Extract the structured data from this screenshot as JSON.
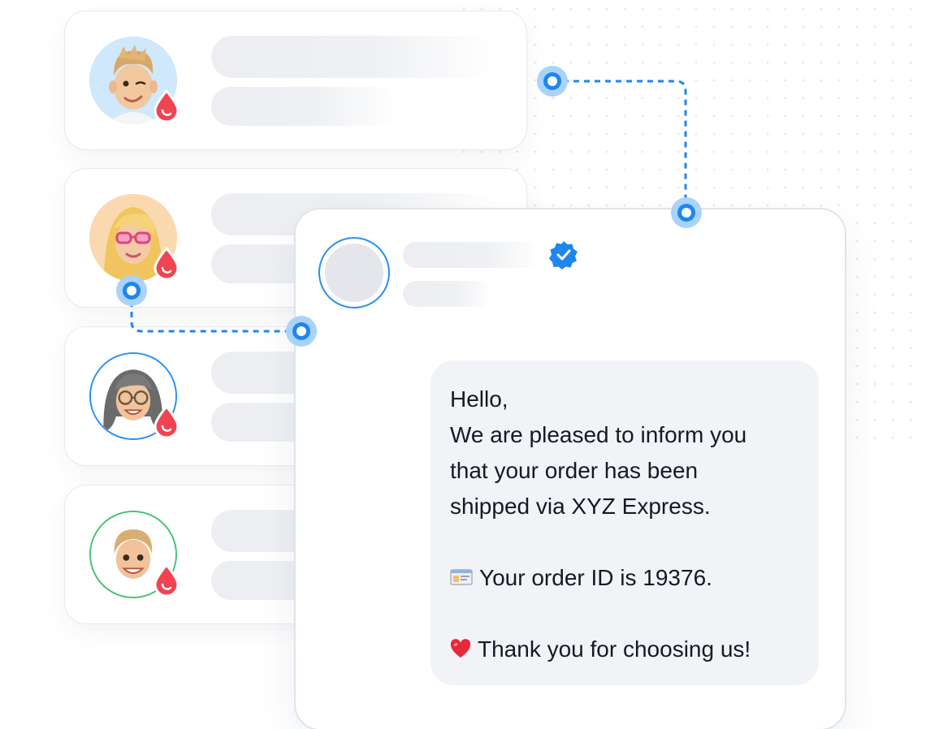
{
  "contacts": [
    {
      "avatar": "memoji-man-winking",
      "badge": "drop-icon",
      "ring": "none",
      "avatar_bg": "#cfe8fb"
    },
    {
      "avatar": "memoji-woman-blonde-pink-glasses",
      "badge": "drop-icon",
      "ring": "none",
      "avatar_bg": "#fbd9b0"
    },
    {
      "avatar": "memoji-woman-gray-hair-glasses",
      "badge": "drop-icon",
      "ring": "#2b8ef0",
      "avatar_bg": "#ffffff"
    },
    {
      "avatar": "memoji-woman-bun",
      "badge": "drop-icon",
      "ring": "#46c171",
      "avatar_bg": "#ffffff"
    }
  ],
  "message": {
    "sender_badge": "verified-check-icon",
    "lines": [
      "Hello,",
      "We are pleased to inform you",
      "that your order has been",
      "shipped via XYZ Express.",
      "Your order ID is 19376.",
      "Thank you for choosing us!"
    ],
    "icons": {
      "order_line": "id-card-emoji",
      "thanks_line": "red-heart-emoji"
    }
  },
  "colors": {
    "accent": "#1f86ee",
    "accent_light": "#a9d3fb",
    "drop": "#f04452",
    "bubble": "#f1f3f7",
    "placeholder": "#eceef2"
  }
}
